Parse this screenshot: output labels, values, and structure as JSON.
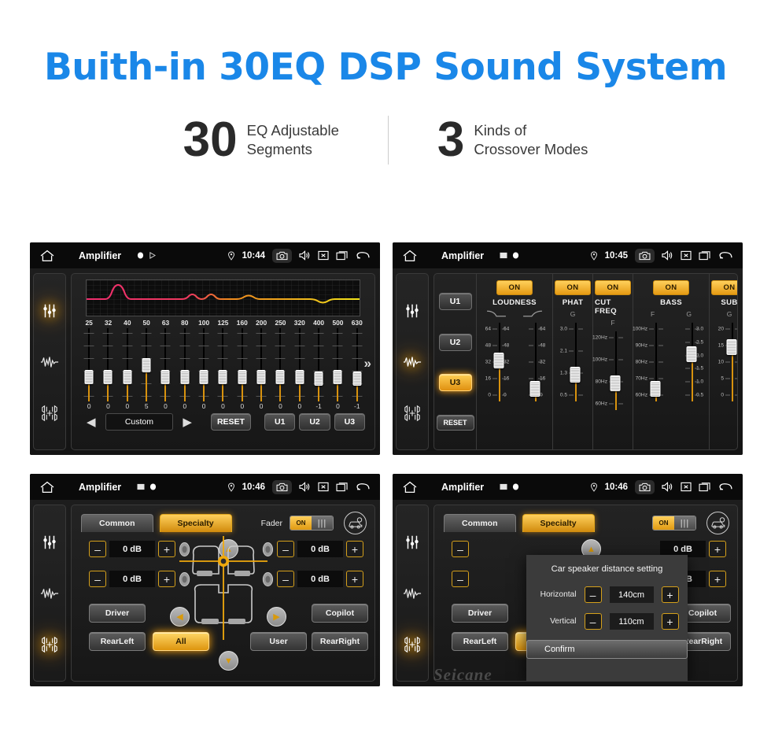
{
  "hero": {
    "title": "Buith-in 30EQ DSP Sound System",
    "stats": [
      {
        "num": "30",
        "line1": "EQ Adjustable",
        "line2": "Segments"
      },
      {
        "num": "3",
        "line1": "Kinds of",
        "line2": "Crossover Modes"
      }
    ]
  },
  "colors": {
    "title_blue": "#1a87e8",
    "accent_amber": "#e09a12",
    "panel_dark": "#1d1d1d",
    "curve_low": "#ef2d6e",
    "curve_mid": "#f08a1e",
    "curve_high": "#f2e41a"
  },
  "screens": [
    {
      "id": "eq-screen",
      "statusbar": {
        "title": "Amplifier",
        "time": "10:44",
        "icons": [
          "home-icon",
          "record-icon",
          "play-icon",
          "location-pin-icon",
          "camera-icon",
          "volume-icon",
          "close-box-icon",
          "recents-icon",
          "back-arrow-icon"
        ]
      },
      "sidebar": [
        {
          "name": "equalizer-icon",
          "active": true
        },
        {
          "name": "waveform-icon",
          "active": false
        },
        {
          "name": "balance-icon",
          "active": false
        }
      ],
      "eq": {
        "frequencies": [
          "25",
          "32",
          "40",
          "50",
          "63",
          "80",
          "100",
          "125",
          "160",
          "200",
          "250",
          "320",
          "400",
          "500",
          "630"
        ],
        "values": [
          0,
          0,
          0,
          5,
          0,
          0,
          0,
          0,
          0,
          0,
          0,
          0,
          -1,
          0,
          -1
        ],
        "value_labels": [
          "0",
          "0",
          "0",
          "5",
          "0",
          "0",
          "0",
          "0",
          "0",
          "0",
          "0",
          "0",
          "-1",
          "0",
          "-1"
        ],
        "preset_label": "Custom",
        "reset_label": "RESET",
        "user_presets": [
          "U1",
          "U2",
          "U3"
        ],
        "prev_icon": "left-triangle-icon",
        "next_icon": "right-triangle-icon",
        "more_icon": "double-chevron-right-icon"
      }
    },
    {
      "id": "dsp-screen",
      "statusbar": {
        "title": "Amplifier",
        "time": "10:45"
      },
      "sidebar": [
        {
          "name": "equalizer-icon",
          "active": false
        },
        {
          "name": "waveform-icon",
          "active": true
        },
        {
          "name": "balance-icon",
          "active": false
        }
      ],
      "presets": [
        {
          "label": "U1",
          "active": false
        },
        {
          "label": "U2",
          "active": false
        },
        {
          "label": "U3",
          "active": true
        },
        {
          "label": "RESET",
          "active": false
        }
      ],
      "sections": [
        {
          "name": "LOUDNESS",
          "state": "ON",
          "sliders": [
            {
              "sub": "low-shelf-curve-icon",
              "scale_left": [
                "64",
                "48",
                "32",
                "16",
                "0"
              ],
              "scale_right": [
                "64",
                "48",
                "32",
                "16",
                "0"
              ],
              "value_pct": 52
            },
            {
              "sub": "high-shelf-curve-icon",
              "scale_left": [],
              "scale_right": [
                "64",
                "48",
                "32",
                "16",
                "0"
              ],
              "value_pct": 7
            }
          ]
        },
        {
          "name": "PHAT",
          "state": "ON",
          "sliders": [
            {
              "sub": "G",
              "scale_left": [
                "3.0",
                "2.1",
                "1.3",
                "0.5"
              ],
              "scale_right": [],
              "value_pct": 30
            }
          ]
        },
        {
          "name": "CUT FREQ",
          "state": "ON",
          "sliders": [
            {
              "sub": "F",
              "scale_left": [
                "120Hz",
                "100Hz",
                "80Hz",
                "60Hz"
              ],
              "scale_right": [],
              "value_pct": 30
            }
          ]
        },
        {
          "name": "BASS",
          "state": "ON",
          "sliders": [
            {
              "sub": "F",
              "scale_left": [
                "100Hz",
                "90Hz",
                "80Hz",
                "70Hz",
                "60Hz"
              ],
              "scale_right": [],
              "value_pct": 8
            },
            {
              "sub": "G",
              "scale_left": [],
              "scale_right": [
                "3.0",
                "2.5",
                "2.0",
                "1.5",
                "1.0",
                "0.5"
              ],
              "value_pct": 62
            }
          ]
        },
        {
          "name": "SUB",
          "state": "ON",
          "sliders": [
            {
              "sub": "G",
              "scale_left": [
                "20",
                "15",
                "10",
                "5",
                "0"
              ],
              "scale_right": [],
              "value_pct": 74
            }
          ]
        }
      ]
    },
    {
      "id": "fader-screen",
      "statusbar": {
        "title": "Amplifier",
        "time": "10:46"
      },
      "sidebar": [
        {
          "name": "equalizer-icon",
          "active": false
        },
        {
          "name": "waveform-icon",
          "active": false
        },
        {
          "name": "balance-icon",
          "active": true
        }
      ],
      "tabs": [
        {
          "label": "Common",
          "active": false
        },
        {
          "label": "Specialty",
          "active": true
        }
      ],
      "fader": {
        "label": "Fader",
        "toggle_state": "ON",
        "car_setting_icon": "car-gear-icon",
        "levels": [
          {
            "pos": "front-left",
            "value": "0 dB"
          },
          {
            "pos": "rear-left",
            "value": "0 dB"
          },
          {
            "pos": "front-right",
            "value": "0 dB"
          },
          {
            "pos": "rear-right",
            "value": "0 dB"
          }
        ],
        "minus_label": "–",
        "plus_label": "+",
        "positions": [
          {
            "label": "Driver",
            "active": false
          },
          {
            "label": "RearLeft",
            "active": false
          },
          {
            "label": "All",
            "active": true
          },
          {
            "label": "User",
            "active": false
          },
          {
            "label": "Copilot",
            "active": false
          },
          {
            "label": "RearRight",
            "active": false
          }
        ],
        "nav_icons": [
          "up-triangle-icon",
          "down-triangle-icon",
          "left-triangle-icon",
          "right-triangle-icon"
        ]
      }
    },
    {
      "id": "distance-dialog-screen",
      "statusbar": {
        "title": "Amplifier",
        "time": "10:46"
      },
      "dialog": {
        "title": "Car speaker distance setting",
        "rows": [
          {
            "label": "Horizontal",
            "value": "140cm"
          },
          {
            "label": "Vertical",
            "value": "110cm"
          }
        ],
        "confirm_label": "Confirm",
        "minus_label": "–",
        "plus_label": "+"
      },
      "watermark": "Seicane"
    }
  ]
}
